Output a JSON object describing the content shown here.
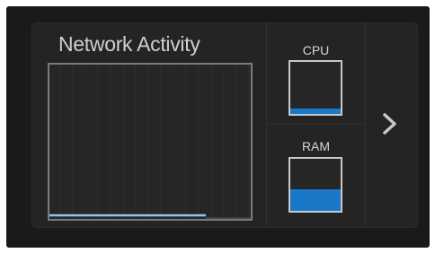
{
  "network": {
    "title": "Network Activity",
    "activity_level": 0.02
  },
  "meters": {
    "cpu": {
      "label": "CPU",
      "level": 0.1
    },
    "ram": {
      "label": "RAM",
      "level": 0.42
    }
  },
  "colors": {
    "meter_fill": "#1a78c8",
    "graph_line": "#8fc7f0",
    "title_text": "#cfcfcf"
  },
  "icons": {
    "next": "chevron-right-icon"
  }
}
